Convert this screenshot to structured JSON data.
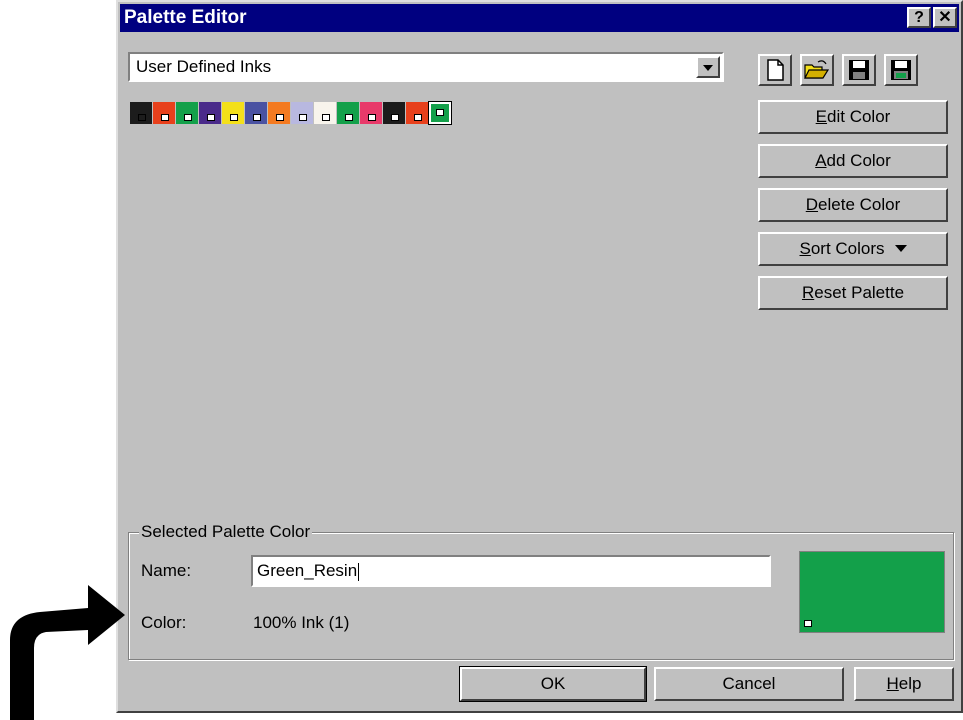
{
  "window": {
    "title": "Palette Editor",
    "help_btn": "?",
    "close_btn": "✕"
  },
  "palette_combo": {
    "value": "User Defined Inks"
  },
  "toolbar": {
    "new": "new-document-icon",
    "open": "open-folder-icon",
    "save": "save-icon",
    "save_as": "save-as-icon"
  },
  "swatches": [
    {
      "color": "#1c1c1c"
    },
    {
      "color": "#e8401c"
    },
    {
      "color": "#13a04a"
    },
    {
      "color": "#4a2a8a"
    },
    {
      "color": "#f4e01a"
    },
    {
      "color": "#4a52a2"
    },
    {
      "color": "#f47a20"
    },
    {
      "color": "#b8b8e0"
    },
    {
      "color": "#f8f4ec"
    },
    {
      "color": "#13a04a"
    },
    {
      "color": "#e83a6a"
    },
    {
      "color": "#1c1c1c"
    },
    {
      "color": "#e8401c"
    },
    {
      "color": "#13a04a",
      "selected": true
    }
  ],
  "side_buttons": [
    {
      "label": "Edit Color",
      "accel": "E",
      "rest": "dit Color"
    },
    {
      "label": "Add Color",
      "accel": "A",
      "rest": "dd Color"
    },
    {
      "label": "Delete Color",
      "accel": "D",
      "rest": "elete Color"
    },
    {
      "label": "Sort Colors",
      "accel": "S",
      "rest": "ort Colors",
      "dropdown": true
    },
    {
      "label": "Reset Palette",
      "accel": "R",
      "rest": "eset Palette"
    }
  ],
  "selected": {
    "group_label": "Selected Palette Color",
    "name_label": "Name:",
    "name_value": "Green_Resin",
    "color_label": "Color:",
    "color_value": "100%  Ink (1)",
    "preview_color": "#13a04a"
  },
  "buttons": {
    "ok": "OK",
    "cancel": "Cancel",
    "help_accel": "H",
    "help_rest": "elp"
  }
}
